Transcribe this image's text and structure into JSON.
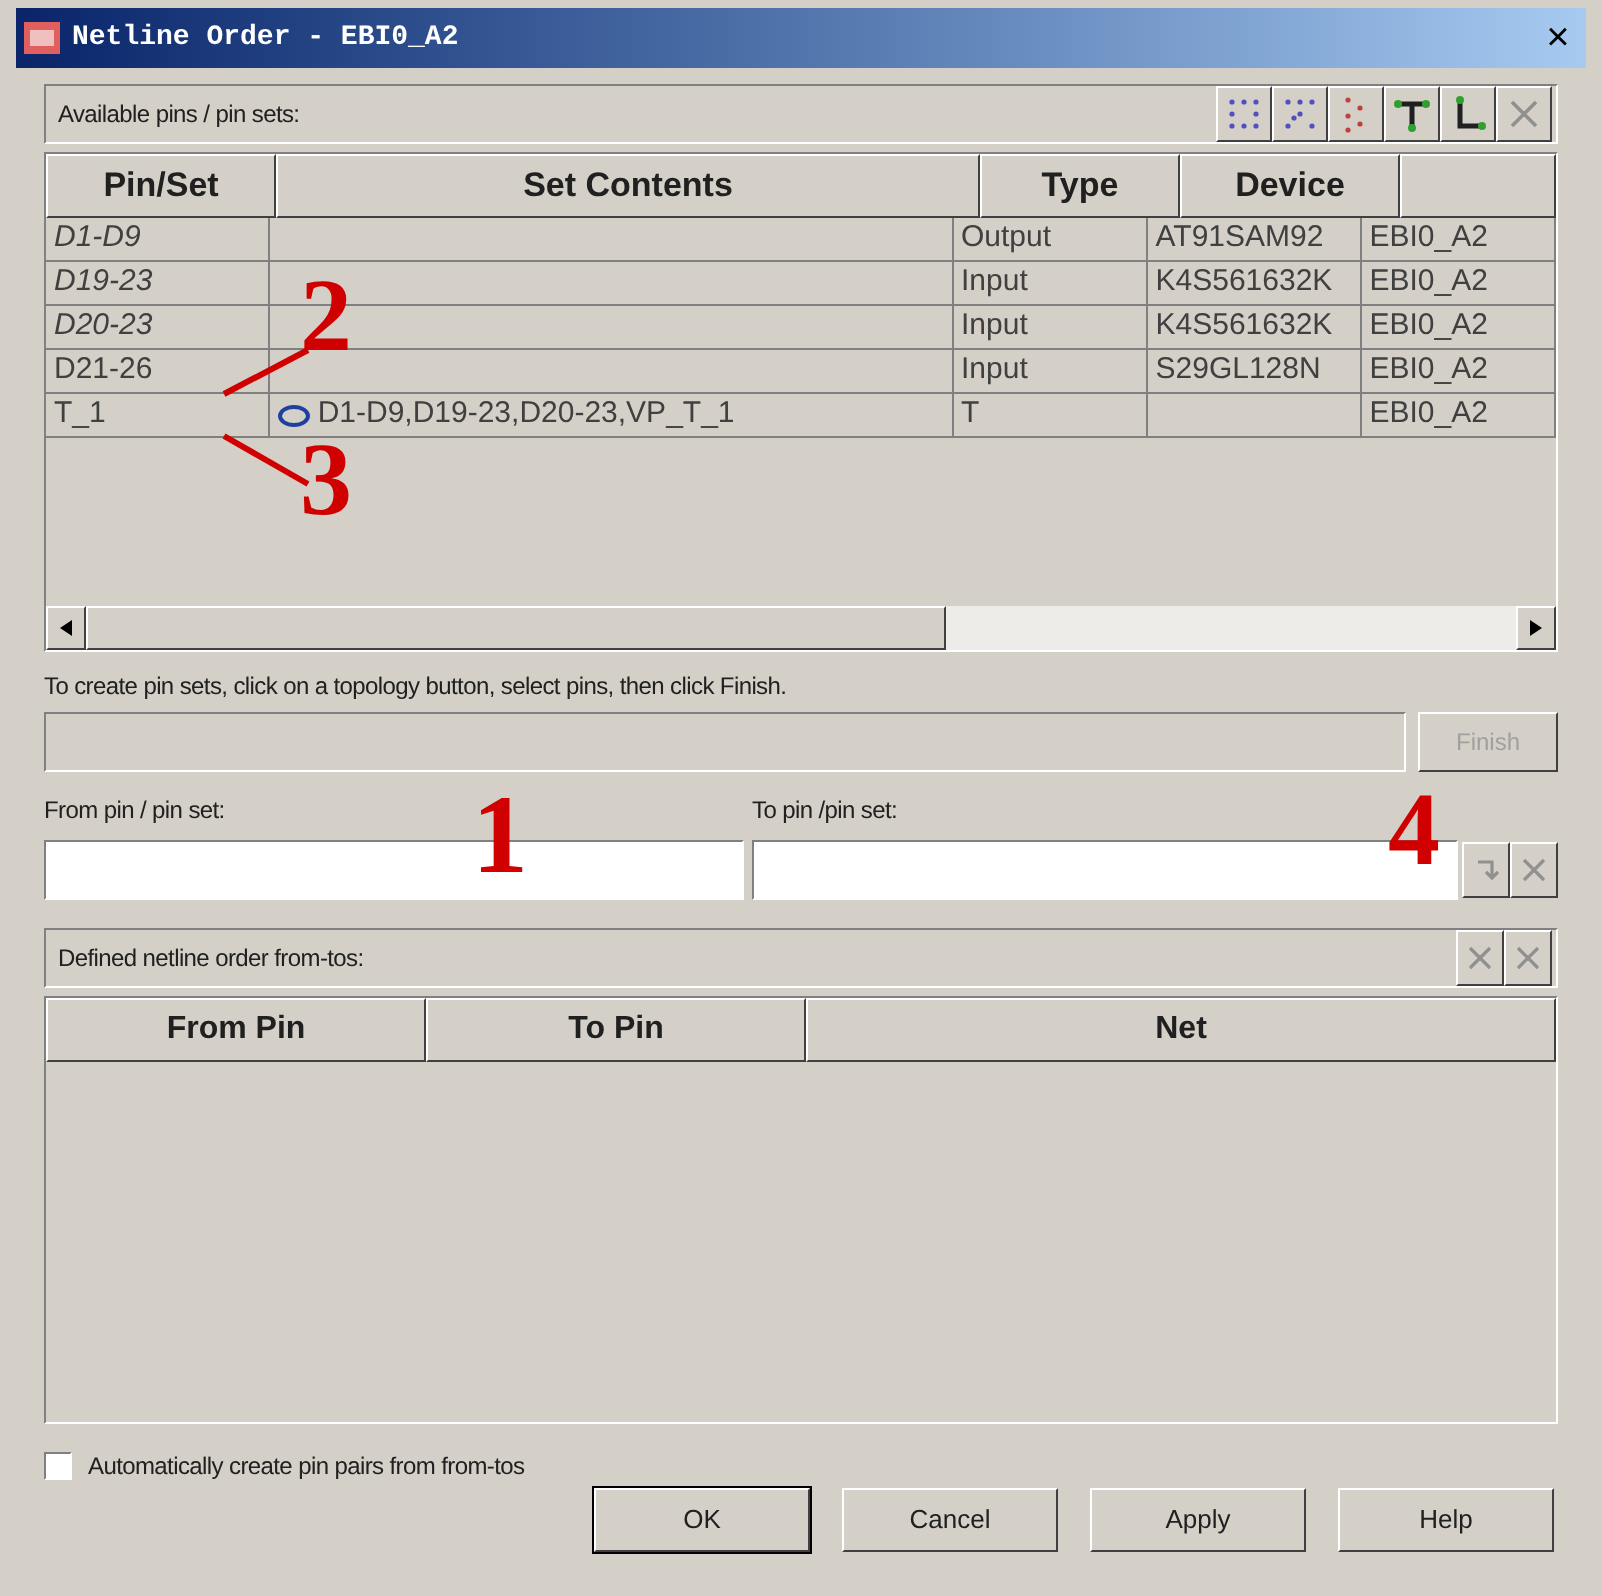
{
  "window": {
    "title": "Netline Order  -  EBI0_A2",
    "close": "×"
  },
  "available": {
    "label": "Available pins / pin sets:",
    "tools": [
      {
        "kind": "dots"
      },
      {
        "kind": "star"
      },
      {
        "kind": "chain"
      },
      {
        "kind": "tee"
      },
      {
        "kind": "ell"
      },
      {
        "kind": "close",
        "disabled": true
      }
    ]
  },
  "pins_table": {
    "columns": [
      "Pin/Set",
      "Set Contents",
      "Type",
      "Device"
    ],
    "rows": [
      {
        "cells": [
          "D1-D9",
          "",
          "Output",
          "AT91SAM92",
          "EBI0_A2"
        ],
        "italic": true,
        "expandable": false
      },
      {
        "cells": [
          "D19-23",
          "",
          "Input",
          "K4S561632K",
          "EBI0_A2"
        ],
        "italic": true,
        "expandable": false
      },
      {
        "cells": [
          "D20-23",
          "",
          "Input",
          "K4S561632K",
          "EBI0_A2"
        ],
        "italic": true,
        "expandable": false
      },
      {
        "cells": [
          "D21-26",
          "",
          "Input",
          "S29GL128N",
          "EBI0_A2"
        ],
        "italic": false,
        "expandable": false
      },
      {
        "cells": [
          "T_1",
          "D1-D9,D19-23,D20-23,VP_T_1",
          "T",
          "",
          "EBI0_A2"
        ],
        "italic": false,
        "expandable": true
      }
    ]
  },
  "instruction": "To create pin sets, click on a topology button, select pins, then click Finish.",
  "finish_button": {
    "label": "Finish",
    "disabled": true
  },
  "from_field": {
    "label": "From pin / pin set:"
  },
  "to_field": {
    "label": "To pin /pin set:"
  },
  "defined": {
    "label": "Defined netline order from-tos:",
    "columns": [
      "From Pin",
      "To Pin",
      "Net"
    ]
  },
  "auto_pairs": {
    "label": "Automatically create pin pairs from from-tos",
    "checked": false
  },
  "buttons": [
    {
      "label": "OK",
      "default": true
    },
    {
      "label": "Cancel",
      "default": false
    },
    {
      "label": "Apply",
      "default": false
    },
    {
      "label": "Help",
      "default": false
    }
  ],
  "annotations": [
    "1",
    "2",
    "3",
    "4"
  ]
}
